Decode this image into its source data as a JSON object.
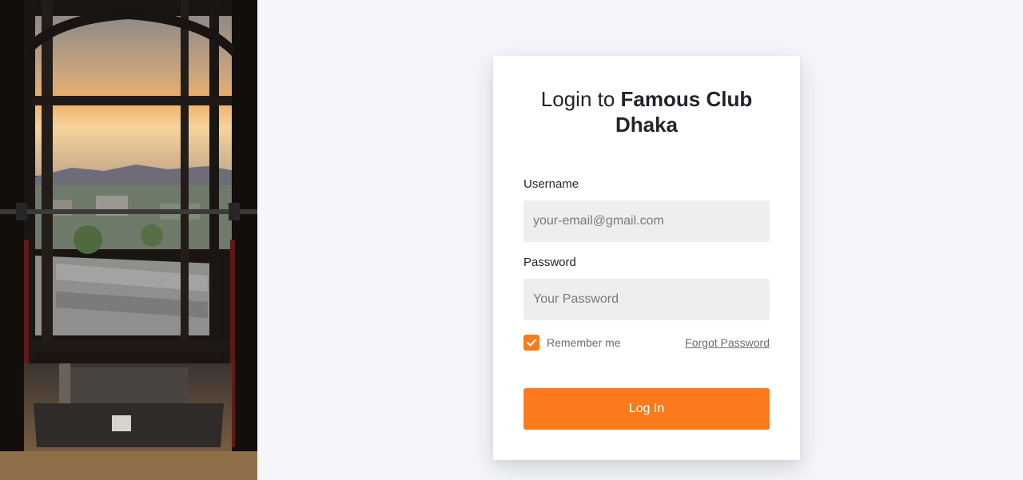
{
  "title": {
    "prefix": "Login to ",
    "club_line1": "Famous Club",
    "club_line2": "Dhaka"
  },
  "form": {
    "username_label": "Username",
    "username_placeholder": "your-email@gmail.com",
    "username_value": "",
    "password_label": "Password",
    "password_placeholder": "Your Password",
    "password_value": "",
    "remember_label": "Remember me",
    "remember_checked": true,
    "forgot_link": "Forgot Password",
    "submit_label": "Log In"
  },
  "colors": {
    "accent": "#fd7a1c",
    "background": "#f4f6fa",
    "input_bg": "#eeeeee"
  },
  "icons": [
    "checkmark-icon"
  ]
}
